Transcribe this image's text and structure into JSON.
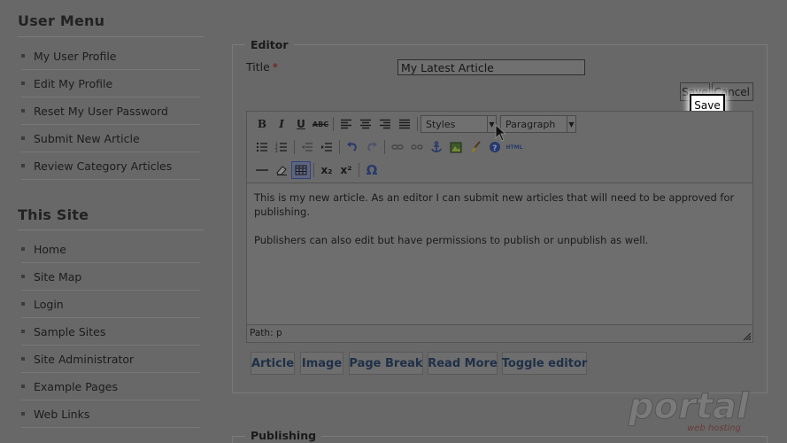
{
  "sidebar": {
    "user_menu": {
      "heading": "User Menu",
      "items": [
        "My User Profile",
        "Edit My Profile",
        "Reset My User Password",
        "Submit New Article",
        "Review Category Articles"
      ]
    },
    "this_site": {
      "heading": "This Site",
      "items": [
        "Home",
        "Site Map",
        "Login",
        "Sample Sites",
        "Site Administrator",
        "Example Pages",
        "Web Links"
      ]
    }
  },
  "editor": {
    "legend": "Editor",
    "title_label": "Title",
    "required_mark": "*",
    "title_value": "My Latest Article",
    "save_button": "Save",
    "cancel_button": "Cancel",
    "save_tooltip": "Save",
    "toolbar": {
      "bold": "B",
      "italic": "I",
      "underline": "U",
      "strikethrough": "ABC",
      "styles_select": "Styles",
      "format_select": "Paragraph",
      "html_label": "HTML",
      "subscript": "x₂",
      "superscript": "x²",
      "omega": "Ω"
    },
    "content_paragraphs": [
      "This is my new article. As an editor I can submit new articles that will need to be approved for publishing.",
      "Publishers can also edit but have permissions to publish or unpublish as well."
    ],
    "path_text": "Path: p",
    "xtd_buttons": [
      "Article",
      "Image",
      "Page Break",
      "Read More",
      "Toggle editor"
    ]
  },
  "publishing": {
    "legend": "Publishing"
  },
  "logo": {
    "text": "portal",
    "subtext": "web hosting"
  },
  "colors": {
    "background": "#686868",
    "tooltip_bg": "#ffffff",
    "xtd_text": "#1f3048"
  }
}
